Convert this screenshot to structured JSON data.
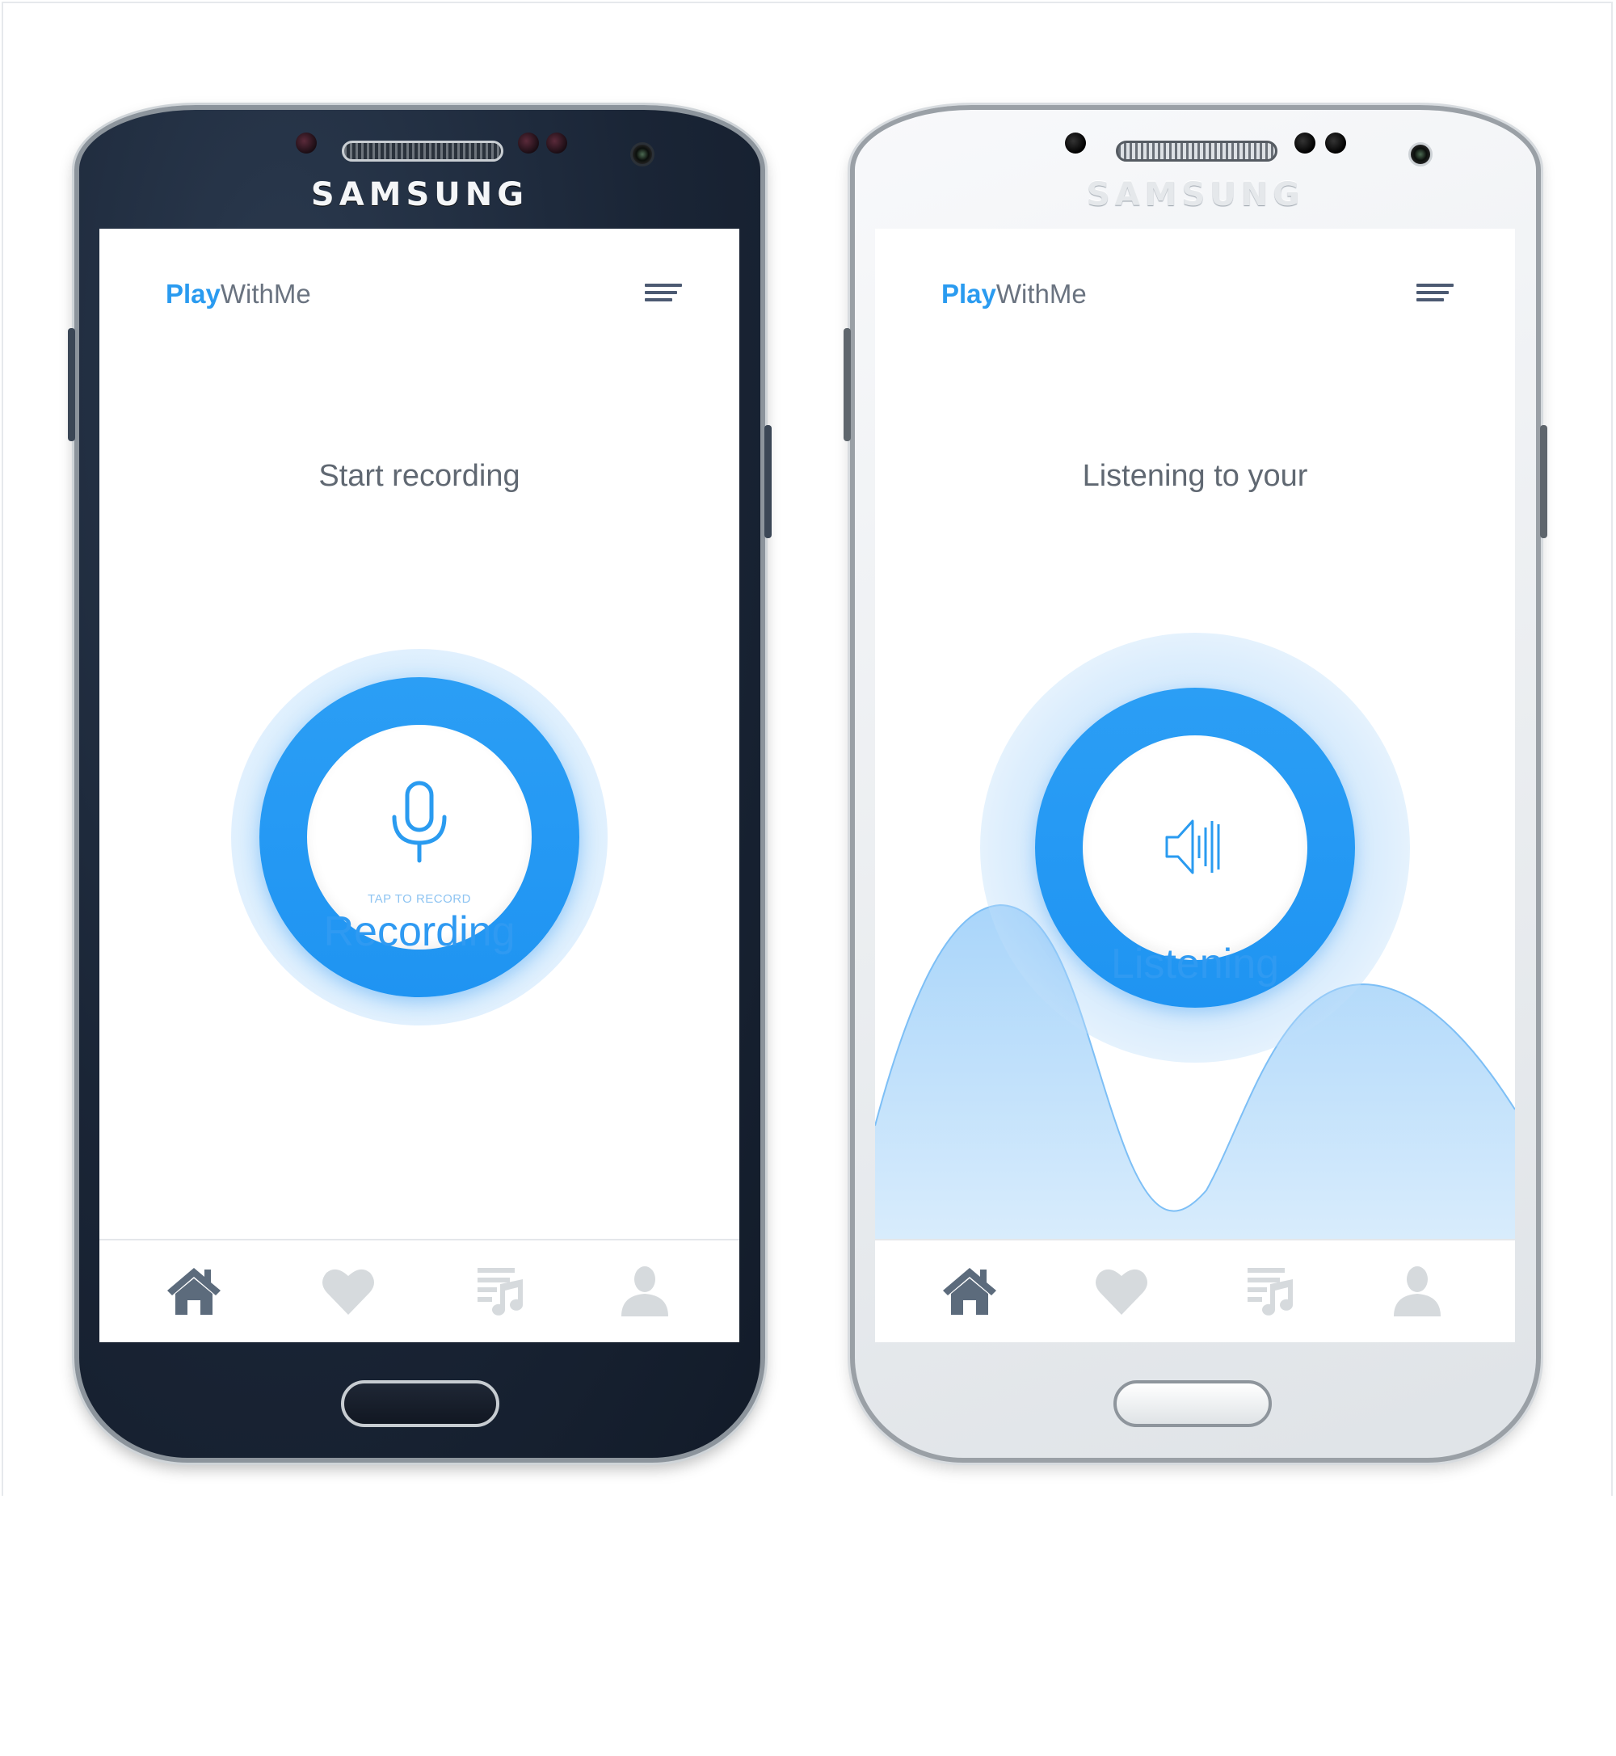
{
  "devices": {
    "brand": "SAMSUNG"
  },
  "app": {
    "logo_play": "Play",
    "logo_rest": "WithMe"
  },
  "screen_left": {
    "prompt": "Start recording",
    "tap_label": "TAP TO RECORD",
    "state_label": "Recording"
  },
  "screen_right": {
    "prompt": "Listening to your",
    "state_label": "Listening"
  },
  "tabbar": {
    "items": [
      {
        "icon": "home-icon",
        "active": true
      },
      {
        "icon": "heart-icon",
        "active": false
      },
      {
        "icon": "playlist-icon",
        "active": false
      },
      {
        "icon": "user-icon",
        "active": false
      }
    ]
  },
  "colors": {
    "accent": "#2a9bf0",
    "tab_active": "#5c6b7c",
    "tab_inactive": "#d6dadd",
    "wave_fill": "#bfe0fb"
  }
}
